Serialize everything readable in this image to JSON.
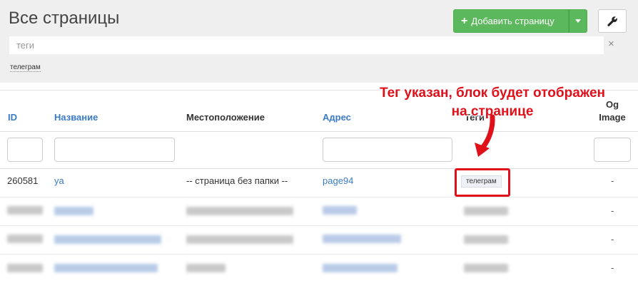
{
  "header": {
    "title": "Все страницы",
    "add_button": "Добавить страницу",
    "tag_placeholder": "теги",
    "clear_symbol": "×",
    "active_tag": "телеграм"
  },
  "table": {
    "columns": {
      "id": "ID",
      "name": "Название",
      "location": "Местоположение",
      "address": "Адрес",
      "tags": "Теги",
      "og_image_1": "Og",
      "og_image_2": "Image"
    },
    "row1": {
      "id": "260581",
      "name": "ya",
      "location": "-- страница без папки --",
      "address": "page94",
      "tag": "телеграм",
      "og": "-"
    },
    "blurred_rows_og": [
      "-",
      "-",
      "-"
    ]
  },
  "annotation": {
    "line1": "Тег указан, блок будет отображен",
    "line2": "на странице",
    "color": "#e0101a"
  },
  "colors": {
    "primary_button": "#5cb85c",
    "link": "#3a7bc8",
    "highlight": "#e0101a"
  },
  "icons": [
    "plus-icon",
    "caret-down-icon",
    "wrench-icon",
    "close-icon",
    "arrow-icon"
  ]
}
